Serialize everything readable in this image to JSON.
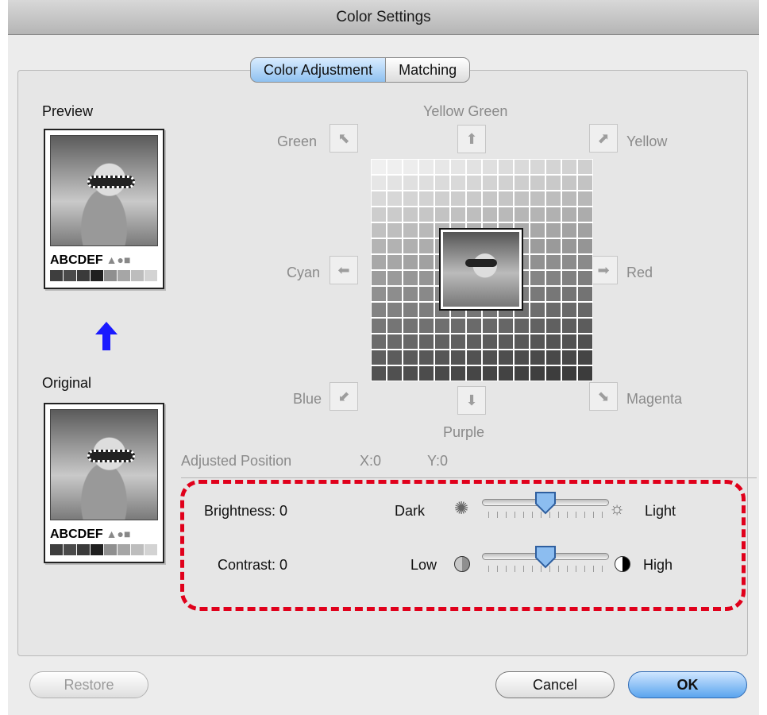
{
  "window": {
    "title": "Color Settings"
  },
  "tabs": [
    {
      "label": "Color Adjustment",
      "active": true
    },
    {
      "label": "Matching",
      "active": false
    }
  ],
  "preview": {
    "label": "Preview",
    "sample_text": "ABCDEF",
    "swatch_colors": [
      "#3e3e3e",
      "#4a4a4a",
      "#3a3a3a",
      "#1f1f1f",
      "#8f8f8f",
      "#a6a6a6",
      "#bdbdbd",
      "#d3d3d3"
    ]
  },
  "original": {
    "label": "Original",
    "sample_text": "ABCDEF",
    "swatch_colors": [
      "#3e3e3e",
      "#4a4a4a",
      "#3a3a3a",
      "#1f1f1f",
      "#8f8f8f",
      "#a6a6a6",
      "#bdbdbd",
      "#d3d3d3"
    ]
  },
  "directions": {
    "green": "Green",
    "yellow_green": "Yellow Green",
    "yellow": "Yellow",
    "cyan": "Cyan",
    "red": "Red",
    "blue": "Blue",
    "purple": "Purple",
    "magenta": "Magenta"
  },
  "adjusted_position": {
    "label": "Adjusted Position",
    "x": "X:0",
    "y": "Y:0"
  },
  "brightness": {
    "label": "Brightness: 0",
    "min_label": "Dark",
    "max_label": "Light",
    "value": 0,
    "min": -50,
    "max": 50
  },
  "contrast": {
    "label": "Contrast: 0",
    "min_label": "Low",
    "max_label": "High",
    "value": 0,
    "min": -50,
    "max": 50
  },
  "buttons": {
    "restore": "Restore",
    "cancel": "Cancel",
    "ok": "OK"
  },
  "colors": {
    "accent": "#5aa4ee",
    "highlight_border": "#e0001b",
    "arrow": "#1a1aff"
  }
}
